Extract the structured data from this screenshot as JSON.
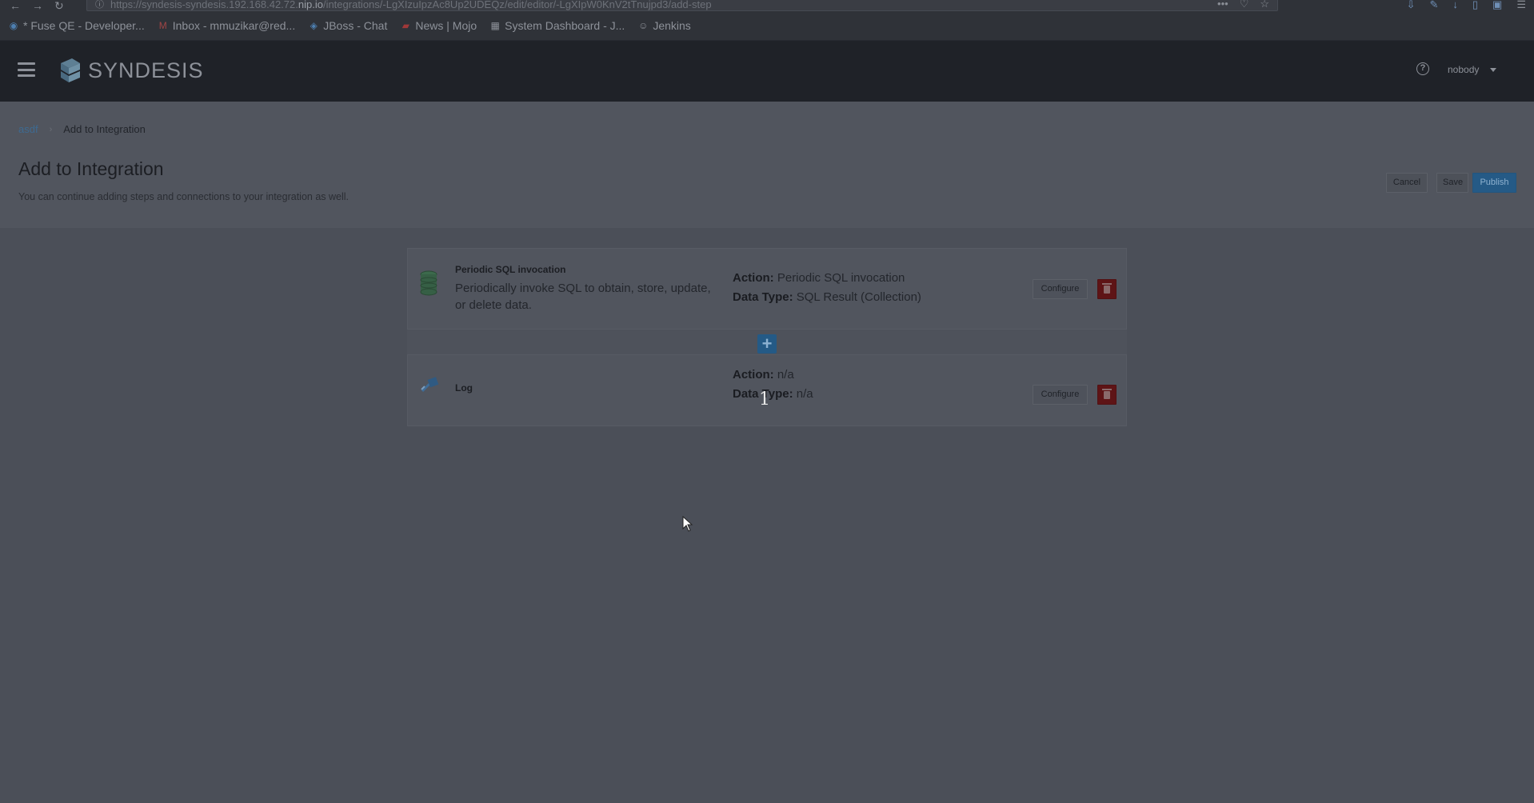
{
  "browser": {
    "url_prefix": "https://syndesis-syndesis.192.168.42.72.",
    "url_host": "nip.io",
    "url_path": "/integrations/-LgXIzuIpzAc8Up2UDEQz/edit/editor/-LgXIpW0KnV2tTnujpd3/add-step",
    "bookmarks": [
      {
        "icon": "fuse-icon",
        "glyph": "◉",
        "label": "* Fuse QE - Developer..."
      },
      {
        "icon": "gmail-icon",
        "glyph": "M",
        "label": "Inbox - mmuzikar@red..."
      },
      {
        "icon": "jboss-icon",
        "glyph": "◈",
        "label": "JBoss - Chat"
      },
      {
        "icon": "mojo-icon",
        "glyph": "▰",
        "label": "News | Mojo"
      },
      {
        "icon": "dashboard-icon",
        "glyph": "▦",
        "label": "System Dashboard - J..."
      },
      {
        "icon": "jenkins-icon",
        "glyph": "☺",
        "label": "Jenkins"
      }
    ]
  },
  "app": {
    "brand": "SYNDESIS",
    "user": "nobody",
    "help_glyph": "?"
  },
  "breadcrumb": {
    "parent": "asdf",
    "current": "Add to Integration"
  },
  "page": {
    "title": "Add to Integration",
    "subtitle": "You can continue adding steps and connections to your integration as well.",
    "cancel_label": "Cancel",
    "save_label": "Save",
    "publish_label": "Publish"
  },
  "steps": [
    {
      "name": "Periodic SQL invocation",
      "description": "Periodically invoke SQL to obtain, store, update, or delete data.",
      "action_label": "Action:",
      "action_value": "Periodic SQL invocation",
      "datatype_label": "Data Type:",
      "datatype_value": "SQL Result (Collection)",
      "configure_label": "Configure"
    },
    {
      "name": "Log",
      "description": "",
      "action_label": "Action:",
      "action_value": "n/a",
      "datatype_label": "Data Type:",
      "datatype_value": "n/a",
      "configure_label": "Configure"
    }
  ],
  "add_step_glyph": "+",
  "cursor_text": "1",
  "colors": {
    "accent": "#245a86",
    "danger": "#5e1416",
    "header": "#1f2228"
  }
}
